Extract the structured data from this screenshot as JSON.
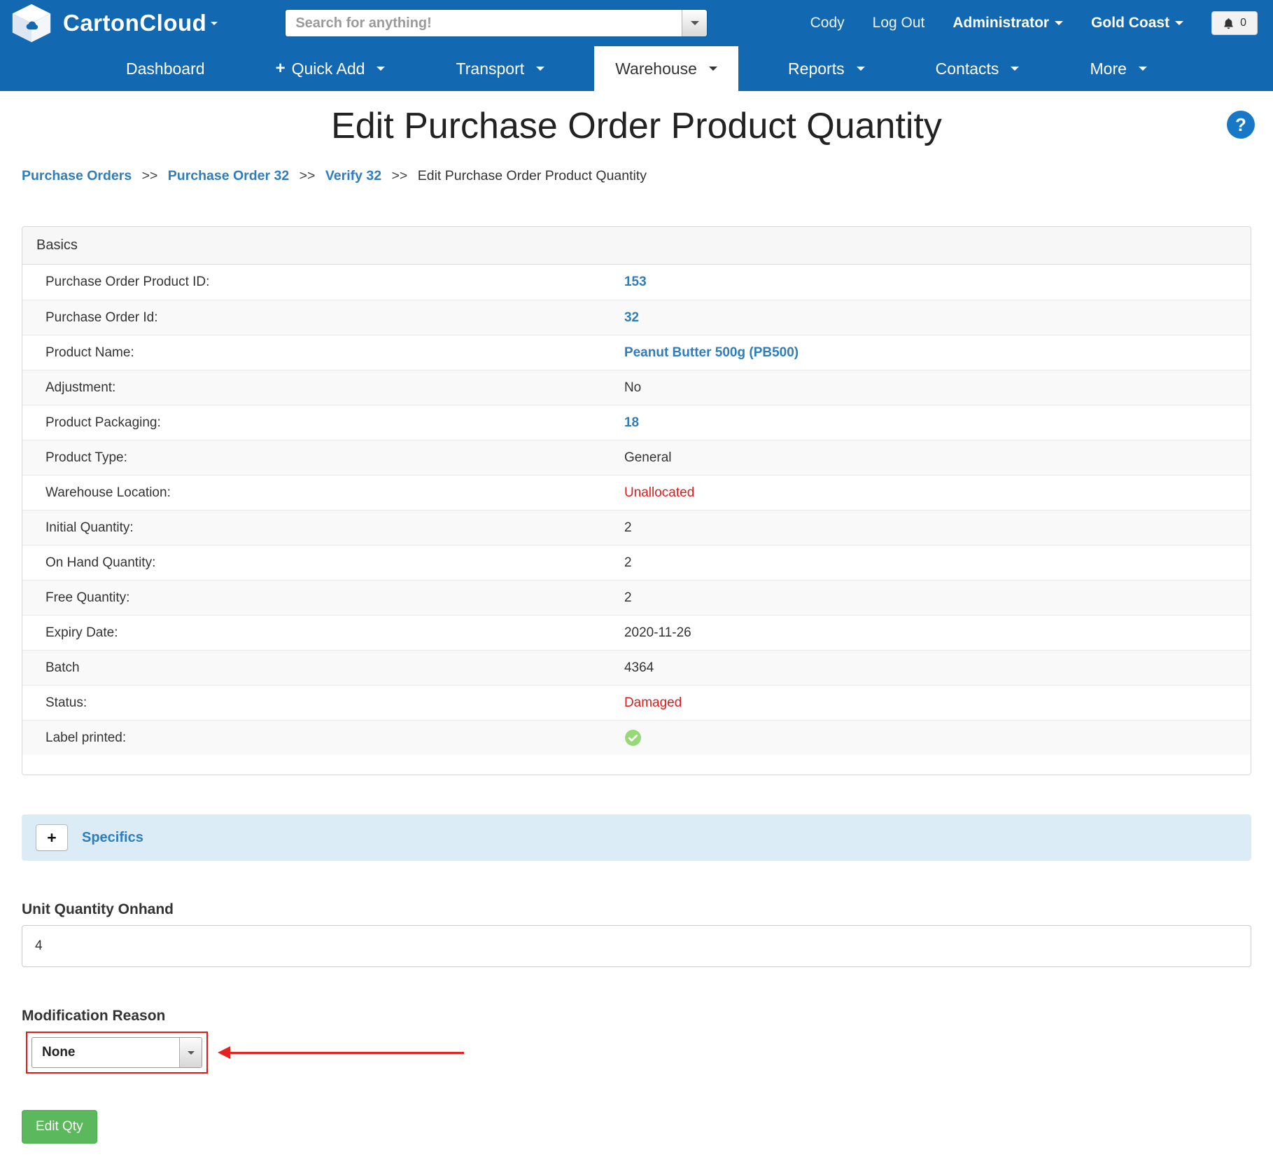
{
  "colors": {
    "header_blue": "#1268b1",
    "link_blue": "#2e7dbe",
    "danger_red": "#e01b1b",
    "success_green": "#5cb85c",
    "specifics_bg": "#dcecf6"
  },
  "icons": {
    "plus": "+"
  },
  "header": {
    "brand": "CartonCloud",
    "search_placeholder": "Search for anything!",
    "user_name": "Cody",
    "logout_label": "Log Out",
    "role_label": "Administrator",
    "tenant_label": "Gold Coast",
    "notification_count": "0"
  },
  "nav": {
    "items": [
      {
        "label": "Dashboard"
      },
      {
        "label": "Quick Add"
      },
      {
        "label": "Transport"
      },
      {
        "label": "Warehouse"
      },
      {
        "label": "Reports"
      },
      {
        "label": "Contacts"
      },
      {
        "label": "More"
      }
    ]
  },
  "page": {
    "title": "Edit Purchase Order Product Quantity",
    "help_label": "?"
  },
  "breadcrumb": {
    "separator": ">>",
    "items": [
      {
        "label": "Purchase Orders"
      },
      {
        "label": "Purchase Order 32"
      },
      {
        "label": "Verify 32"
      },
      {
        "label": "Edit Purchase Order Product Quantity"
      }
    ]
  },
  "basics": {
    "title": "Basics",
    "rows": [
      {
        "label": "Purchase Order Product ID:",
        "value": "153"
      },
      {
        "label": "Purchase Order Id:",
        "value": "32"
      },
      {
        "label": "Product Name:",
        "value": "Peanut Butter 500g (PB500)"
      },
      {
        "label": "Adjustment:",
        "value": "No"
      },
      {
        "label": "Product Packaging:",
        "value": "18"
      },
      {
        "label": "Product Type:",
        "value": "General"
      },
      {
        "label": "Warehouse Location:",
        "value": "Unallocated"
      },
      {
        "label": "Initial Quantity:",
        "value": "2"
      },
      {
        "label": "On Hand Quantity:",
        "value": "2"
      },
      {
        "label": "Free Quantity:",
        "value": "2"
      },
      {
        "label": "Expiry Date:",
        "value": "2020-11-26"
      },
      {
        "label": "Batch",
        "value": "4364"
      },
      {
        "label": "Status:",
        "value": "Damaged"
      },
      {
        "label": "Label printed:",
        "value": "checked"
      }
    ]
  },
  "specifics": {
    "expand_button": "+",
    "title": "Specifics"
  },
  "form": {
    "unit_quantity_label": "Unit Quantity Onhand",
    "unit_quantity_value": "4",
    "modification_reason_label": "Modification Reason",
    "modification_reason_value": "None",
    "submit_label": "Edit Qty"
  }
}
